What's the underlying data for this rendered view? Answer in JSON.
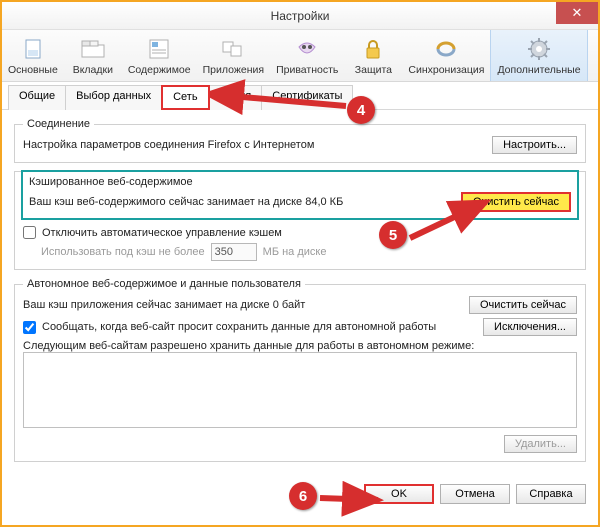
{
  "window": {
    "title": "Настройки"
  },
  "toolbar": {
    "items": [
      {
        "label": "Основные"
      },
      {
        "label": "Вкладки"
      },
      {
        "label": "Содержимое"
      },
      {
        "label": "Приложения"
      },
      {
        "label": "Приватность"
      },
      {
        "label": "Защита"
      },
      {
        "label": "Синхронизация"
      },
      {
        "label": "Дополнительные"
      }
    ]
  },
  "subtabs": {
    "items": [
      {
        "label": "Общие"
      },
      {
        "label": "Выбор данных"
      },
      {
        "label": "Сеть"
      },
      {
        "label": "О…ия"
      },
      {
        "label": "Сертификаты"
      }
    ]
  },
  "conn": {
    "legend": "Соединение",
    "text": "Настройка параметров соединения Firefox с Интернетом",
    "btn": "Настроить..."
  },
  "cache": {
    "legend": "Кэшированное веб-содержимое",
    "status": "Ваш кэш веб-содержимого сейчас занимает на диске 84,0 КБ",
    "clear": "Очистить сейчас",
    "disable": "Отключить автоматическое управление кэшем",
    "limit_pre": "Использовать под кэш не более",
    "limit_val": "350",
    "limit_suf": "МБ на диске"
  },
  "offline": {
    "legend": "Автономное веб-содержимое и данные пользователя",
    "status": "Ваш кэш приложения сейчас занимает на диске 0 байт",
    "clear": "Очистить сейчас",
    "notify": "Сообщать, когда веб-сайт просит сохранить данные для автономной работы",
    "exceptions": "Исключения...",
    "sites_label": "Следующим веб-сайтам разрешено хранить данные для работы в автономном режиме:",
    "delete": "Удалить..."
  },
  "actions": {
    "ok": "OK",
    "cancel": "Отмена",
    "help": "Справка"
  },
  "callouts": {
    "c4": "4",
    "c5": "5",
    "c6": "6"
  }
}
